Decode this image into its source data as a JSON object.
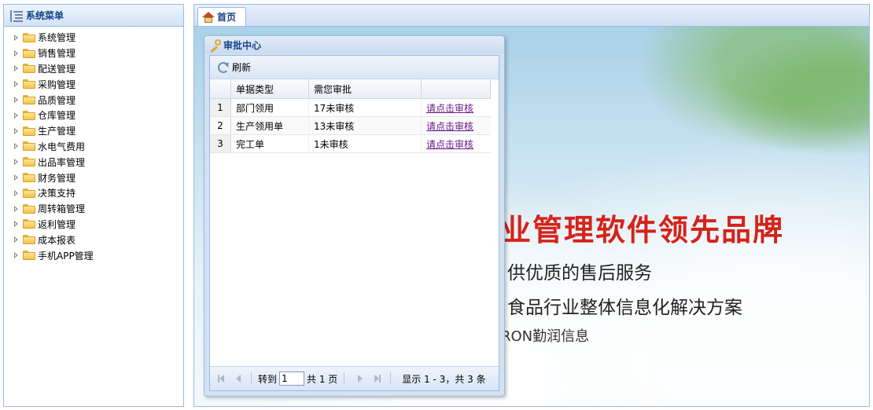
{
  "sidebar": {
    "title": "系统菜单",
    "items": [
      {
        "label": "系统管理"
      },
      {
        "label": "销售管理"
      },
      {
        "label": "配送管理"
      },
      {
        "label": "采购管理"
      },
      {
        "label": "品质管理"
      },
      {
        "label": "仓库管理"
      },
      {
        "label": "生产管理"
      },
      {
        "label": "水电气费用"
      },
      {
        "label": "出品率管理"
      },
      {
        "label": "财务管理"
      },
      {
        "label": "决策支持"
      },
      {
        "label": "周转箱管理"
      },
      {
        "label": "返利管理"
      },
      {
        "label": "成本报表"
      },
      {
        "label": "手机APP管理"
      }
    ]
  },
  "tabs": [
    {
      "label": "首页"
    }
  ],
  "banner": {
    "line1": "业管理软件领先品牌",
    "line2": "供优质的售后服务",
    "line3": "食品行业整体信息化解决方案",
    "line4": "RON勤润信息"
  },
  "panel": {
    "title": "审批中心",
    "refresh_label": "刷新",
    "columns": [
      "单据类型",
      "需您审批",
      ""
    ],
    "rows": [
      {
        "num": "1",
        "type": "部门领用",
        "pending": "17未审核",
        "action": "请点击审核"
      },
      {
        "num": "2",
        "type": "生产领用单",
        "pending": "13未审核",
        "action": "请点击审核"
      },
      {
        "num": "3",
        "type": "完工单",
        "pending": "1未审核",
        "action": "请点击审核"
      }
    ],
    "pager": {
      "goto_label": "转到",
      "page_value": "1",
      "total_label": "共 1 页",
      "summary": "显示 1 - 3，共 3 条"
    }
  },
  "colors": {
    "accent": "#15428b",
    "border": "#99bbe8",
    "slogan_red": "#d4231a",
    "link": "#6b1a8a"
  }
}
